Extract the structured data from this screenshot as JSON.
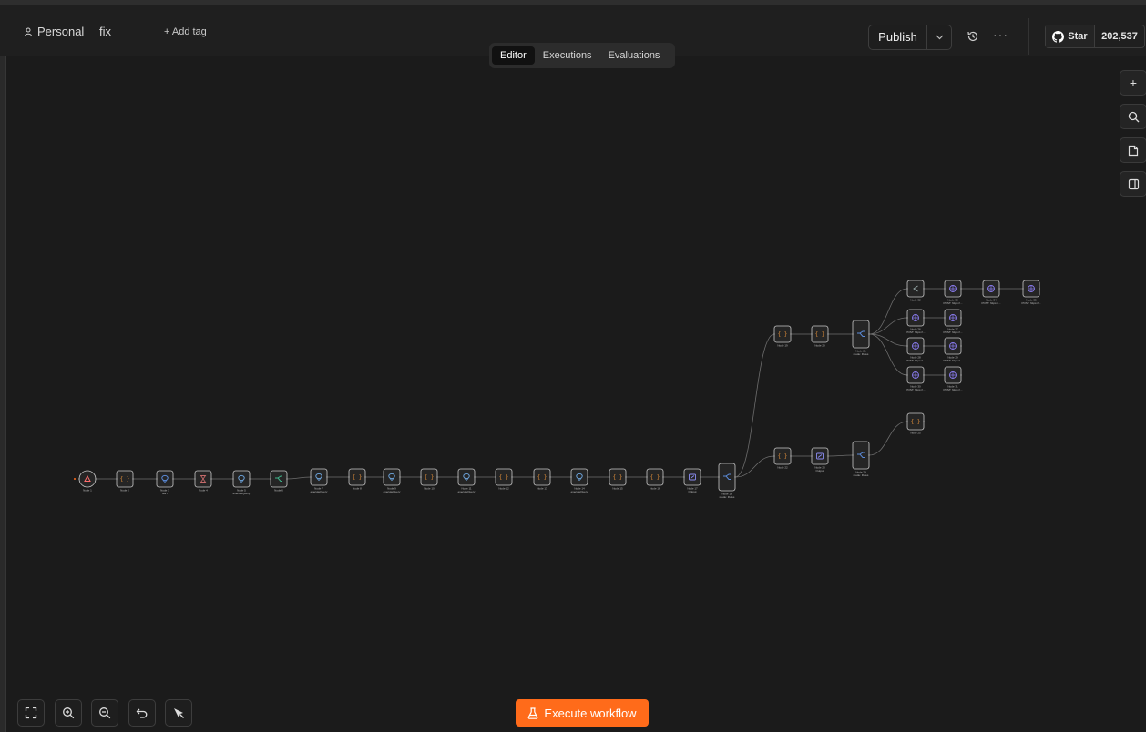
{
  "header": {
    "project": "Personal",
    "workflow_name": "fix",
    "add_tag": "+ Add tag",
    "publish_label": "Publish",
    "github_star_label": "Star",
    "github_star_count": "202,537"
  },
  "tabs": [
    {
      "label": "Editor",
      "active": true
    },
    {
      "label": "Executions",
      "active": false
    },
    {
      "label": "Evaluations",
      "active": false
    }
  ],
  "execute_label": "Execute workflow",
  "colors": {
    "accent": "#ff6b1a",
    "canvas": "#1b1b1b",
    "node_border": "#c9c9c9"
  },
  "nodes": [
    {
      "id": "n1",
      "label": "Node 1",
      "icon": "trigger"
    },
    {
      "id": "n2",
      "label": "Node 2",
      "icon": "code"
    },
    {
      "id": "n3",
      "label": "Node 3",
      "icon": "api",
      "sub": "GET"
    },
    {
      "id": "n4",
      "label": "Node 4",
      "icon": "wait"
    },
    {
      "id": "n5",
      "label": "Node 5",
      "icon": "db",
      "sub": "executeQuery"
    },
    {
      "id": "n6",
      "label": "Node 6",
      "icon": "if"
    },
    {
      "id": "n7",
      "label": "Node 7",
      "icon": "db",
      "sub": "executeQuery"
    },
    {
      "id": "n8",
      "label": "Node 8",
      "icon": "code"
    },
    {
      "id": "n9",
      "label": "Node 9",
      "icon": "db",
      "sub": "executeQuery"
    },
    {
      "id": "n10",
      "label": "Node 10",
      "icon": "code"
    },
    {
      "id": "n11",
      "label": "Node 11",
      "icon": "db",
      "sub": "executeQuery"
    },
    {
      "id": "n12",
      "label": "Node 12",
      "icon": "code"
    },
    {
      "id": "n13",
      "label": "Node 13",
      "icon": "code"
    },
    {
      "id": "n14",
      "label": "Node 14",
      "icon": "db",
      "sub": "executeQuery"
    },
    {
      "id": "n15",
      "label": "Node 15",
      "icon": "code"
    },
    {
      "id": "n16",
      "label": "Node 16",
      "icon": "code"
    },
    {
      "id": "n17",
      "label": "Node 17",
      "icon": "set",
      "sub": "Output"
    },
    {
      "id": "n18",
      "label": "Node 18",
      "icon": "switch",
      "sub": "mode: Rules"
    },
    {
      "id": "n19",
      "label": "Node 19",
      "icon": "code"
    },
    {
      "id": "n20",
      "label": "Node 20",
      "icon": "code"
    },
    {
      "id": "n21",
      "label": "Node 21",
      "icon": "switch",
      "sub": "mode: Rules"
    },
    {
      "id": "n22",
      "label": "Node 22",
      "icon": "code"
    },
    {
      "id": "n23",
      "label": "Node 23",
      "icon": "set",
      "sub": "Output"
    },
    {
      "id": "n24",
      "label": "Node 24",
      "icon": "switch",
      "sub": "mode: Rules"
    },
    {
      "id": "n25",
      "label": "Node 25",
      "icon": "code"
    },
    {
      "id": "n26",
      "label": "Node 26",
      "icon": "http",
      "sub": "POST: https://..."
    },
    {
      "id": "n27",
      "label": "Node 27",
      "icon": "http",
      "sub": "POST: https://..."
    },
    {
      "id": "n28",
      "label": "Node 28",
      "icon": "http",
      "sub": "POST: https://..."
    },
    {
      "id": "n29",
      "label": "Node 29",
      "icon": "http",
      "sub": "POST: https://..."
    },
    {
      "id": "n30",
      "label": "Node 30",
      "icon": "http",
      "sub": "POST: https://..."
    },
    {
      "id": "n31",
      "label": "Node 31",
      "icon": "http",
      "sub": "POST: https://..."
    },
    {
      "id": "n32",
      "label": "Node 32",
      "icon": "noop"
    },
    {
      "id": "n33",
      "label": "Node 33",
      "icon": "http",
      "sub": "POST: https://..."
    },
    {
      "id": "n34",
      "label": "Node 34",
      "icon": "http",
      "sub": "POST: https://..."
    },
    {
      "id": "n35",
      "label": "Node 35",
      "icon": "http",
      "sub": "POST: https://..."
    }
  ],
  "edges": [
    [
      "n1",
      "n2"
    ],
    [
      "n2",
      "n3"
    ],
    [
      "n3",
      "n4"
    ],
    [
      "n4",
      "n5"
    ],
    [
      "n5",
      "n6"
    ],
    [
      "n6",
      "n7"
    ],
    [
      "n7",
      "n8"
    ],
    [
      "n8",
      "n9"
    ],
    [
      "n9",
      "n10"
    ],
    [
      "n10",
      "n11"
    ],
    [
      "n11",
      "n12"
    ],
    [
      "n12",
      "n13"
    ],
    [
      "n13",
      "n14"
    ],
    [
      "n14",
      "n15"
    ],
    [
      "n15",
      "n16"
    ],
    [
      "n16",
      "n17"
    ],
    [
      "n17",
      "n18"
    ],
    [
      "n18",
      "n19"
    ],
    [
      "n18",
      "n22"
    ],
    [
      "n19",
      "n20"
    ],
    [
      "n20",
      "n21"
    ],
    [
      "n22",
      "n23"
    ],
    [
      "n23",
      "n24"
    ],
    [
      "n24",
      "n25"
    ],
    [
      "n21",
      "n32"
    ],
    [
      "n21",
      "n26"
    ],
    [
      "n21",
      "n28"
    ],
    [
      "n21",
      "n30"
    ],
    [
      "n26",
      "n27"
    ],
    [
      "n28",
      "n29"
    ],
    [
      "n30",
      "n31"
    ],
    [
      "n32",
      "n33"
    ],
    [
      "n33",
      "n34"
    ],
    [
      "n34",
      "n35"
    ]
  ]
}
